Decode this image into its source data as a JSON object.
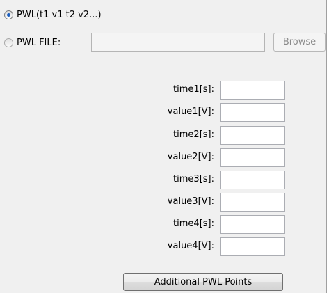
{
  "source_options": [
    {
      "label": "PWL(t1 v1 t2 v2...)",
      "checked": true
    },
    {
      "label": "PWL FILE:",
      "checked": false
    }
  ],
  "file": {
    "value": "",
    "browse_label": "Browse"
  },
  "fields": [
    {
      "label": "time1[s]:",
      "value": ""
    },
    {
      "label": "value1[V]:",
      "value": ""
    },
    {
      "label": "time2[s]:",
      "value": ""
    },
    {
      "label": "value2[V]:",
      "value": ""
    },
    {
      "label": "time3[s]:",
      "value": ""
    },
    {
      "label": "value3[V]:",
      "value": ""
    },
    {
      "label": "time4[s]:",
      "value": ""
    },
    {
      "label": "value4[V]:",
      "value": ""
    }
  ],
  "additional_button_label": "Additional PWL Points",
  "colors": {
    "panel_bg": "#f0f0f0",
    "radio_selected": "#1d5fbf"
  }
}
